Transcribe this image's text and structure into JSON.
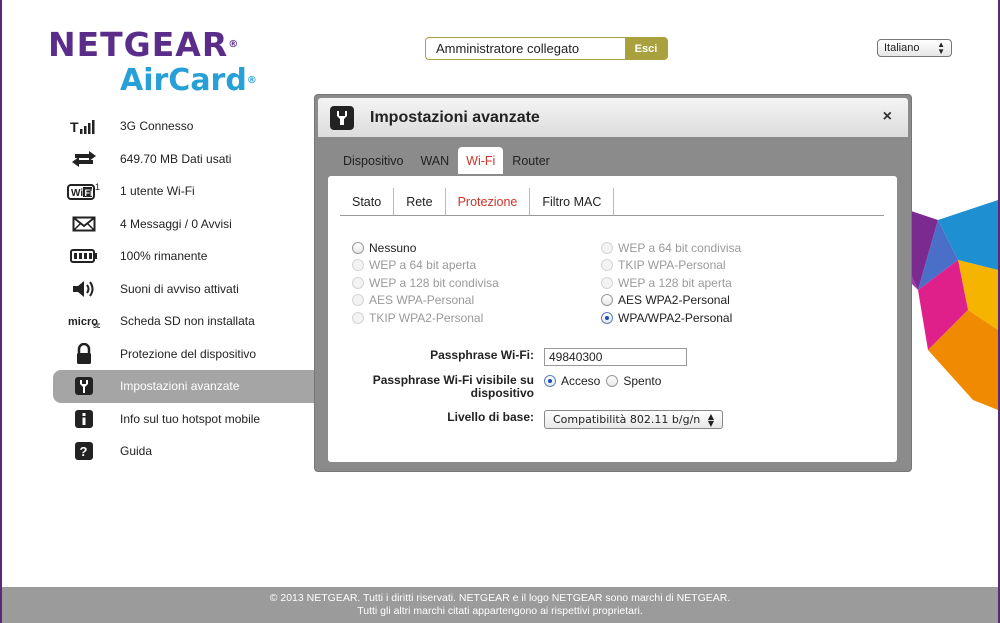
{
  "logo": {
    "brand": "NETGEAR",
    "product": "AirCard",
    "reg": "®"
  },
  "admin": {
    "status": "Amministratore collegato",
    "logout_label": "Esci"
  },
  "language": {
    "selected": "Italiano"
  },
  "sidebar": {
    "items": [
      {
        "label": "3G Connesso",
        "icon": "signal-icon"
      },
      {
        "label": "649.70 MB Dati usati",
        "icon": "data-transfer-icon"
      },
      {
        "label": "1 utente Wi-Fi",
        "icon": "wifi-icon",
        "badge": "1"
      },
      {
        "label": "4 Messaggi / 0 Avvisi",
        "icon": "envelope-icon"
      },
      {
        "label": "100% rimanente",
        "icon": "battery-icon"
      },
      {
        "label": "Suoni di avviso attivati",
        "icon": "speaker-icon"
      },
      {
        "label": "Scheda SD non installata",
        "icon": "microsd-icon"
      },
      {
        "label": "Protezione del dispositivo",
        "icon": "lock-icon"
      },
      {
        "label": "Impostazioni avanzate",
        "icon": "wrench-icon",
        "active": true
      },
      {
        "label": "Info sul tuo hotspot mobile",
        "icon": "info-icon"
      },
      {
        "label": "Guida",
        "icon": "help-icon"
      }
    ]
  },
  "dialog": {
    "title": "Impostazioni avanzate",
    "close_label": "×",
    "tabs": [
      "Dispositivo",
      "WAN",
      "Wi-Fi",
      "Router"
    ],
    "active_tab": "Wi-Fi",
    "subtabs": [
      "Stato",
      "Rete",
      "Protezione",
      "Filtro MAC"
    ],
    "active_subtab": "Protezione",
    "security_left": [
      {
        "label": "Nessuno",
        "enabled": true,
        "checked": false
      },
      {
        "label": "WEP a 64 bit aperta",
        "enabled": false,
        "checked": false
      },
      {
        "label": "WEP a 128 bit condivisa",
        "enabled": false,
        "checked": false
      },
      {
        "label": "AES WPA-Personal",
        "enabled": false,
        "checked": false
      },
      {
        "label": "TKIP WPA2-Personal",
        "enabled": false,
        "checked": false
      }
    ],
    "security_right": [
      {
        "label": "WEP a 64 bit condivisa",
        "enabled": false,
        "checked": false
      },
      {
        "label": "TKIP WPA-Personal",
        "enabled": false,
        "checked": false
      },
      {
        "label": "WEP a 128 bit aperta",
        "enabled": false,
        "checked": false
      },
      {
        "label": "AES WPA2-Personal",
        "enabled": true,
        "checked": false
      },
      {
        "label": "WPA/WPA2-Personal",
        "enabled": true,
        "checked": true
      }
    ],
    "passphrase_label": "Passphrase Wi-Fi:",
    "passphrase_value": "49840300",
    "visible_label_line1": "Passphrase Wi-Fi visibile su",
    "visible_label_line2": "dispositivo",
    "visible_on": "Acceso",
    "visible_off": "Spento",
    "level_label": "Livello di base:",
    "level_value": "Compatibilità 802.11 b/g/n"
  },
  "footer": {
    "line1": "© 2013 NETGEAR. Tutti i diritti riservati. NETGEAR e il logo NETGEAR sono marchi di NETGEAR.",
    "line2": "Tutti gli altri marchi citati appartengono ai rispettivi proprietari."
  },
  "colors": {
    "brand_purple": "#5b2d8a",
    "brand_blue": "#27a0d8",
    "accent_olive": "#a9a03e",
    "active_red": "#d0332a"
  }
}
